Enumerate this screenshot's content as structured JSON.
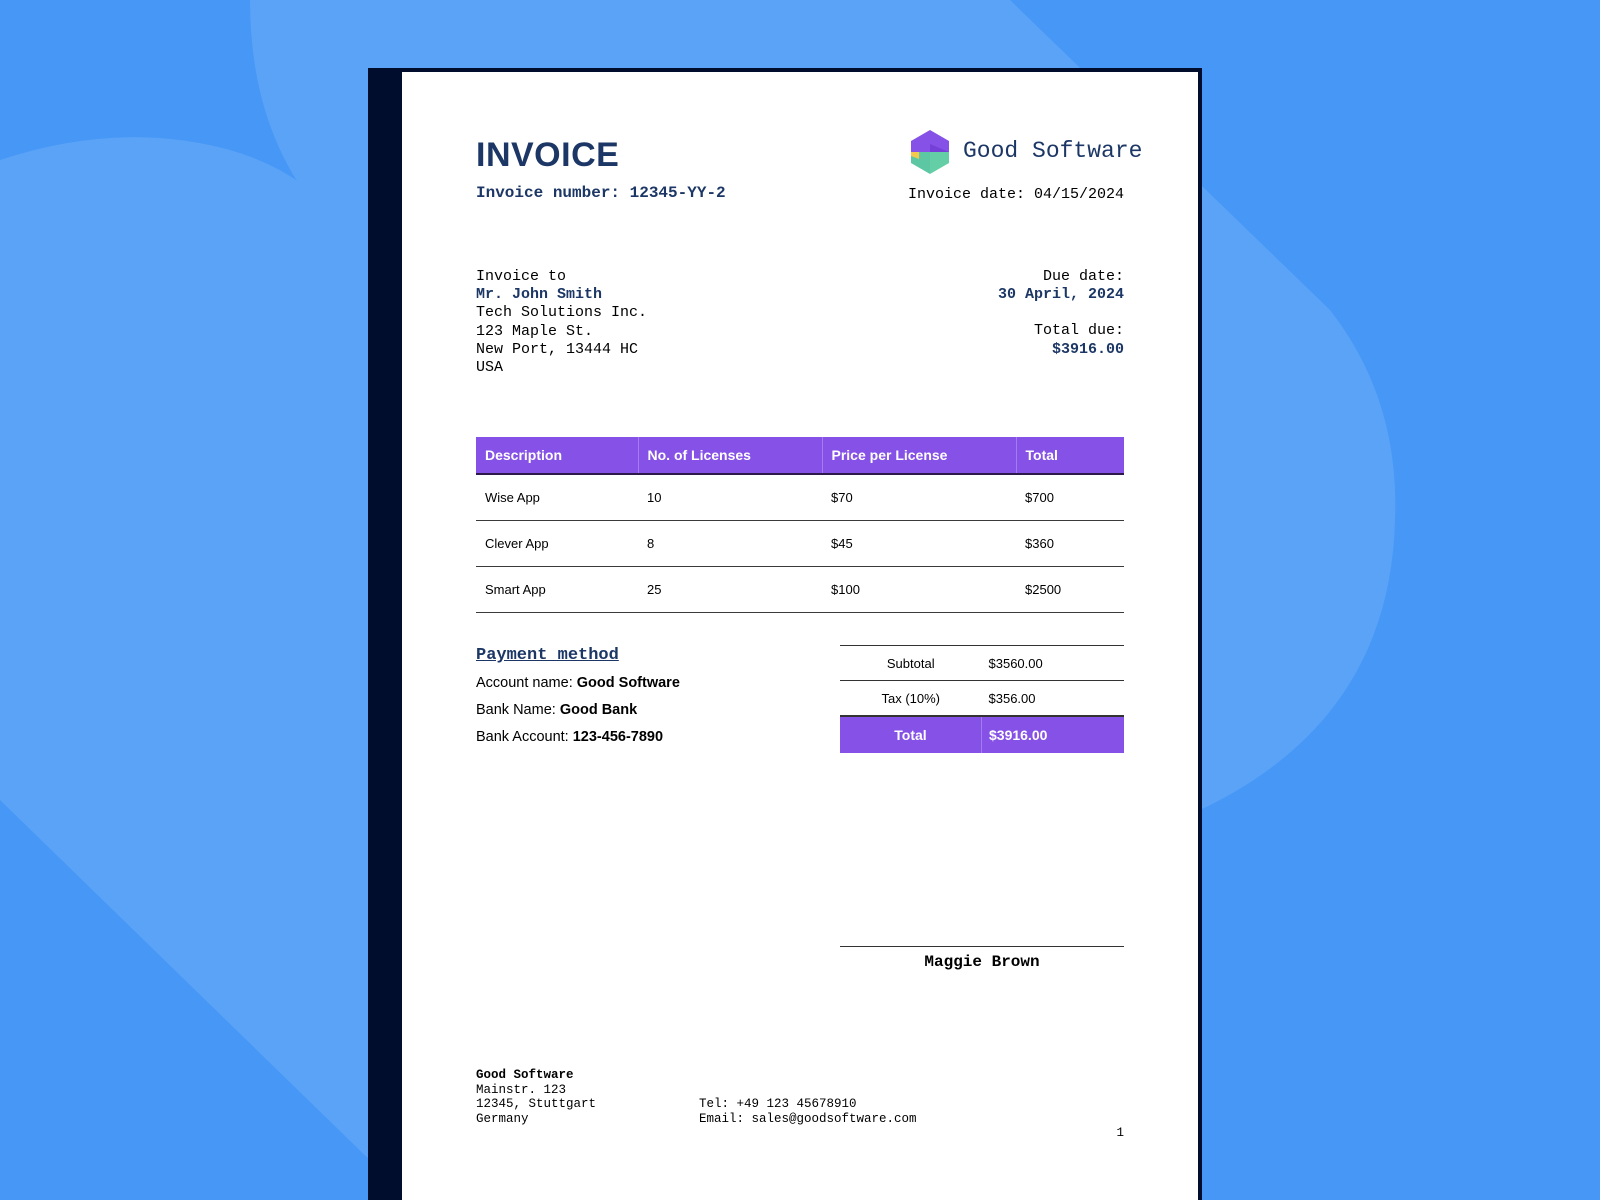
{
  "invoice": {
    "title": "INVOICE",
    "number_label": "Invoice number: 12345-YY-2",
    "date_label": "Invoice date: 04/15/2024"
  },
  "vendor": {
    "name": "Good Software"
  },
  "bill_to": {
    "label": "Invoice to",
    "name": "Mr. John Smith",
    "company": "Tech Solutions Inc.",
    "street": "123 Maple St.",
    "city": "New Port, 13444 HC",
    "country": "USA"
  },
  "due": {
    "date_label": "Due date:",
    "date_value": "30 April, 2024",
    "total_label": "Total due:",
    "total_value": "$3916.00"
  },
  "items_table": {
    "headers": [
      "Description",
      "No. of Licenses",
      "Price per License",
      "Total"
    ],
    "rows": [
      [
        "Wise App",
        "10",
        "$70",
        "$700"
      ],
      [
        "Clever App",
        "8",
        "$45",
        "$360"
      ],
      [
        "Smart App",
        "25",
        "$100",
        "$2500"
      ]
    ]
  },
  "payment": {
    "heading": "Payment method",
    "account_name_label": "Account name:",
    "account_name": "Good Software",
    "bank_name_label": "Bank Name:",
    "bank_name": "Good Bank",
    "bank_account_label": "Bank Account:",
    "bank_account": "123-456-7890"
  },
  "totals": {
    "subtotal_label": "Subtotal",
    "subtotal": "$3560.00",
    "tax_label": "Tax (10%)",
    "tax": "$356.00",
    "total_label": "Total",
    "total": "$3916.00"
  },
  "signature": {
    "name": "Maggie Brown"
  },
  "footer": {
    "company": "Good Software",
    "street": "Mainstr. 123",
    "city": "12345, Stuttgart",
    "country": "Germany",
    "tel": "Tel: +49 123 45678910",
    "email": "Email: sales@goodsoftware.com",
    "page_number": "1"
  },
  "colors": {
    "background": "#4697f6",
    "accent_purple": "#8651e6",
    "navy_text": "#1c3765",
    "page_edge": "#000d2c"
  }
}
